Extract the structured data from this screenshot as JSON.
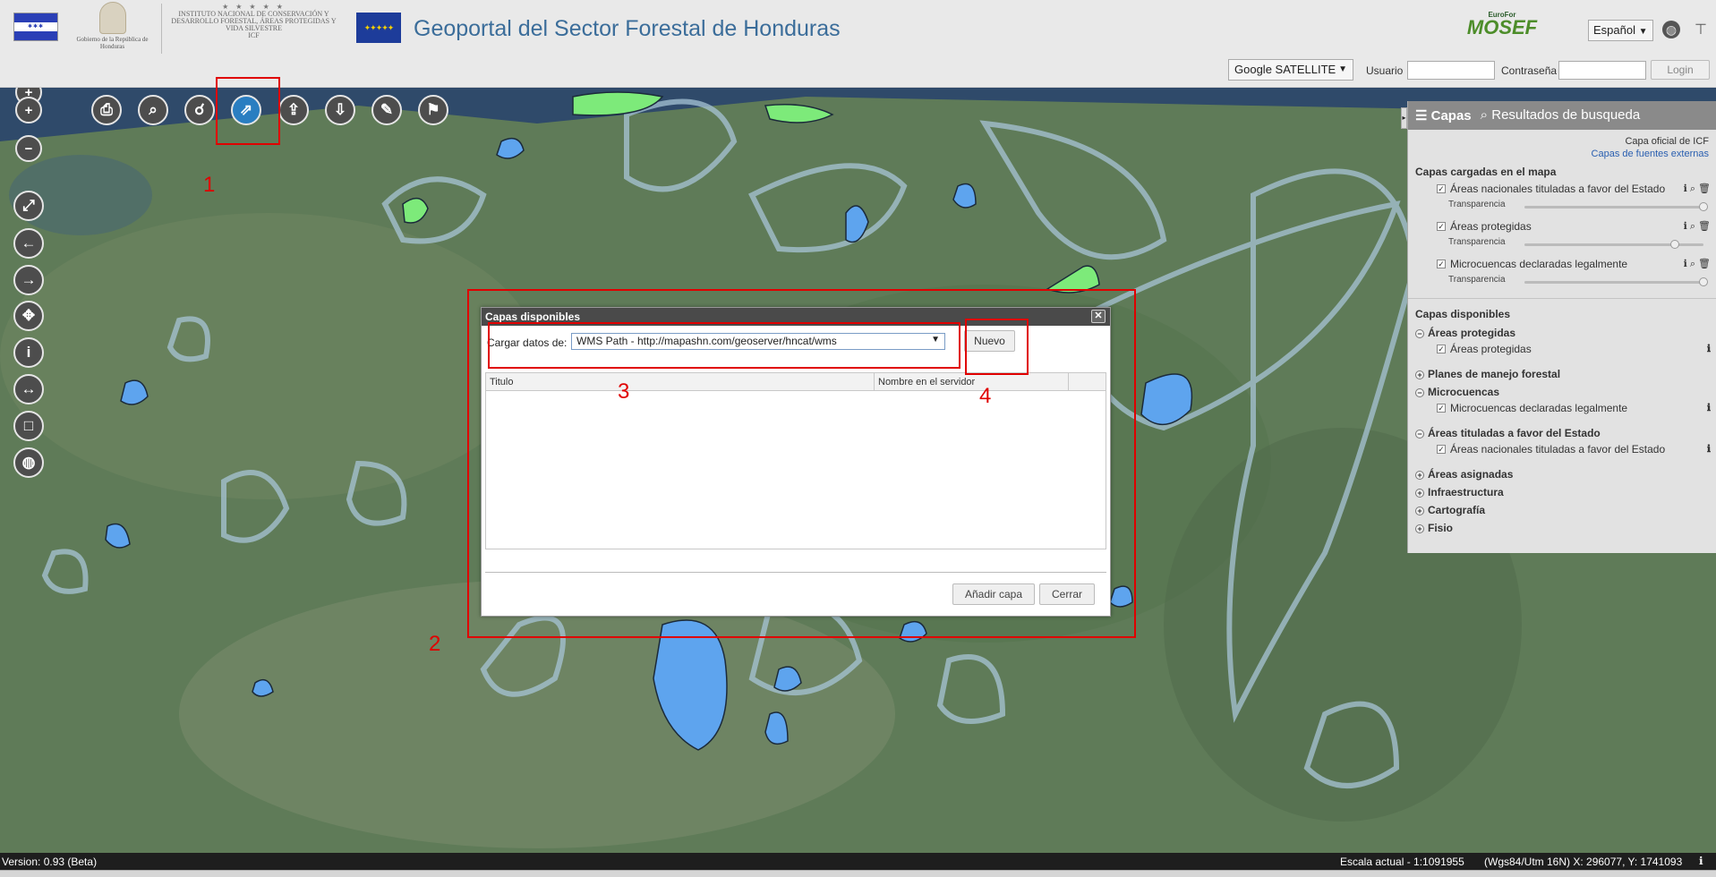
{
  "header": {
    "gov_logo_text": "Gobierno de la República de Honduras",
    "icf_logo_stars": "★ ★ ★ ★ ★",
    "icf_logo_text": "INSTITUTO NACIONAL DE CONSERVACIÓN Y DESARROLLO FORESTAL, ÁREAS PROTEGIDAS Y VIDA SILVESTRE",
    "icf_logo_abbr": "ICF",
    "title": "Geoportal del Sector Forestal de Honduras",
    "mosef_small": "EuroFor",
    "mosef_big": "MOSEF",
    "language": "Español",
    "basemap": "Google SATELLITE",
    "user_label": "Usuario",
    "user_value": "",
    "password_label": "Contraseña",
    "password_value": "",
    "login_label": "Login"
  },
  "icons": {
    "zoom_in": "plus-icon",
    "zoom_out": "minus-icon",
    "print": "print-icon",
    "search": "search-icon",
    "binoculars": "binoculars-icon",
    "external": "external-link-icon",
    "upload": "upload-icon",
    "download": "download-icon",
    "edit": "edit-icon",
    "flag": "flag-icon"
  },
  "annotations": {
    "n1": "1",
    "n2": "2",
    "n3": "3",
    "n4": "4",
    "color": "#e00000"
  },
  "panel": {
    "tab_layers": "Capas",
    "tab_results": "Resultados de busqueda",
    "link_official": "Capa oficial de ICF",
    "link_external": "Capas de fuentes externas",
    "loaded_title": "Capas cargadas en el mapa",
    "transparency_label": "Transparencia",
    "loaded_layers": [
      {
        "name": "Áreas nacionales tituladas a favor del Estado",
        "transparency": 1.0
      },
      {
        "name": "Áreas protegidas",
        "transparency": 0.84
      },
      {
        "name": "Microcuencas declaradas legalmente",
        "transparency": 1.0
      }
    ],
    "available_title": "Capas disponibles",
    "groups": [
      {
        "name": "Áreas protegidas",
        "expanded": true,
        "items": [
          "Áreas protegidas"
        ]
      },
      {
        "name": "Planes de manejo forestal",
        "expanded": false,
        "items": []
      },
      {
        "name": "Microcuencas",
        "expanded": true,
        "items": [
          "Microcuencas declaradas legalmente"
        ]
      },
      {
        "name": "Áreas tituladas a favor del Estado",
        "expanded": true,
        "items": [
          "Áreas nacionales tituladas a favor del Estado"
        ]
      },
      {
        "name": "Áreas asignadas",
        "expanded": false,
        "items": []
      },
      {
        "name": "Infraestructura",
        "expanded": false,
        "items": []
      },
      {
        "name": "Cartografía",
        "expanded": false,
        "items": []
      },
      {
        "name": "Fisio",
        "expanded": false,
        "items": []
      }
    ]
  },
  "dialog": {
    "title": "Capas disponibles",
    "source_label": "Cargar datos de:",
    "source_value": "WMS Path - http://mapashn.com/geoserver/hncat/wms",
    "new_button": "Nuevo",
    "col_title": "Titulo",
    "col_server_name": "Nombre en el servidor",
    "add_button": "Añadir capa",
    "close_button": "Cerrar"
  },
  "status": {
    "version": "Version: 0.93 (Beta)",
    "scale": "Escala actual - 1:1091955",
    "coords": "(Wgs84/Utm 16N) X: 296077, Y: 1741093"
  }
}
